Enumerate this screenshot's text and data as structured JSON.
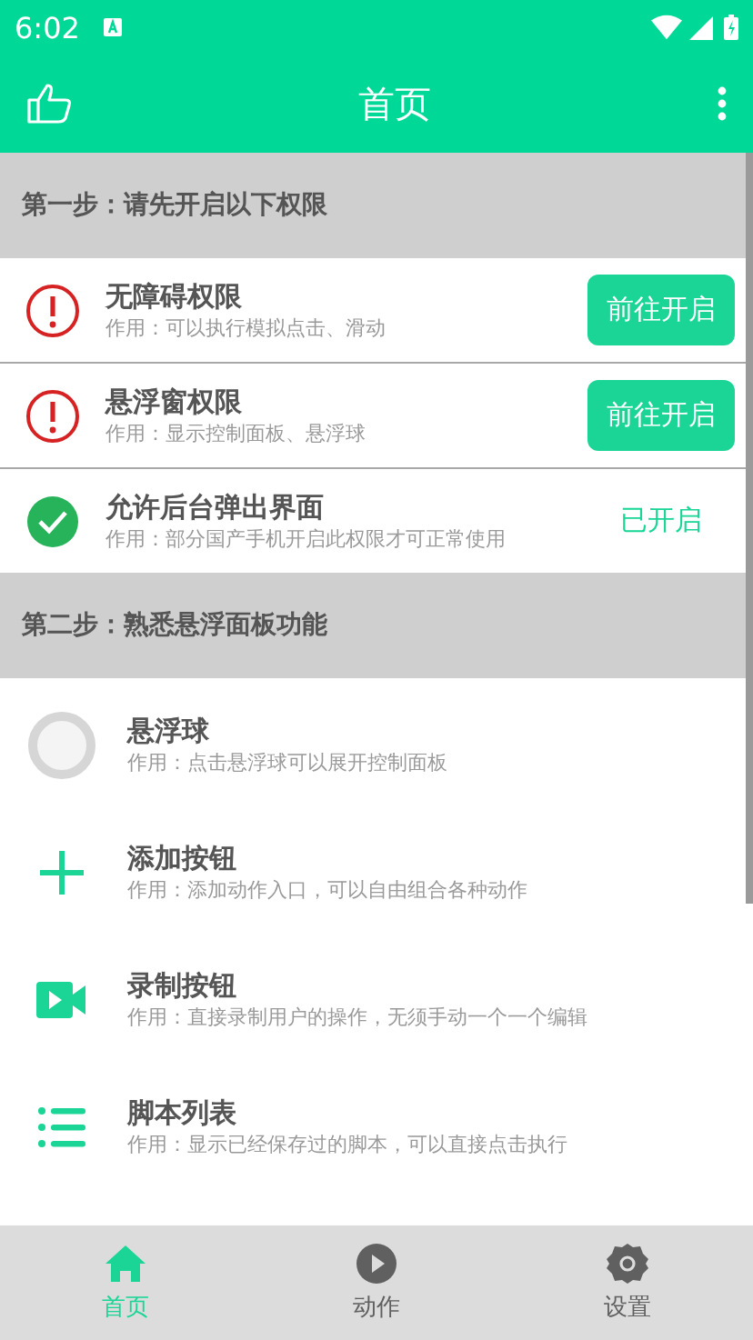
{
  "status_bar": {
    "time": "6:02"
  },
  "app_bar": {
    "title": "首页"
  },
  "sections": [
    {
      "title": "第一步：请先开启以下权限",
      "kind": "permissions",
      "items": [
        {
          "title": "无障碍权限",
          "desc": "作用：可以执行模拟点击、滑动",
          "granted": false,
          "action": "前往开启"
        },
        {
          "title": "悬浮窗权限",
          "desc": "作用：显示控制面板、悬浮球",
          "granted": false,
          "action": "前往开启"
        },
        {
          "title": "允许后台弹出界面",
          "desc": "作用：部分国产手机开启此权限才可正常使用",
          "granted": true,
          "action": "已开启"
        }
      ]
    },
    {
      "title": "第二步：熟悉悬浮面板功能",
      "kind": "features",
      "items": [
        {
          "title": "悬浮球",
          "desc": "作用：点击悬浮球可以展开控制面板",
          "kind": "ball"
        },
        {
          "title": "添加按钮",
          "desc": "作用：添加动作入口，可以自由组合各种动作",
          "kind": "plus"
        },
        {
          "title": "录制按钮",
          "desc": "作用：直接录制用户的操作，无须手动一个一个编辑",
          "kind": "video"
        },
        {
          "title": "脚本列表",
          "desc": "作用：显示已经保存过的脚本，可以直接点击执行",
          "kind": "list"
        }
      ]
    }
  ],
  "tabs": [
    {
      "label": "首页",
      "kind": "home",
      "selected": true
    },
    {
      "label": "动作",
      "kind": "play",
      "selected": false
    },
    {
      "label": "设置",
      "kind": "gear",
      "selected": false
    }
  ]
}
